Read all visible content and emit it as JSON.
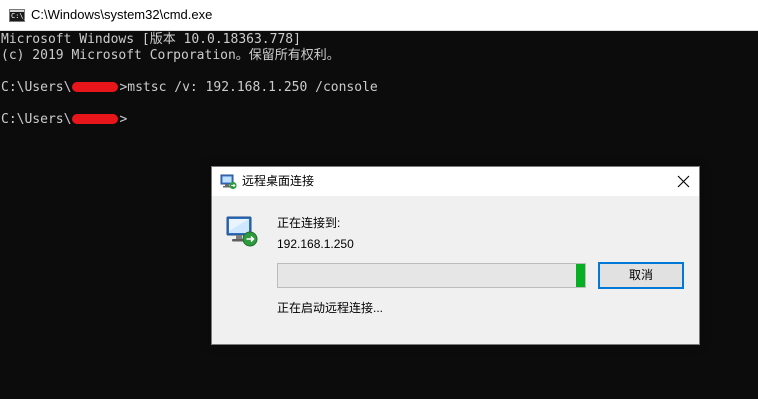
{
  "console_window": {
    "title": "C:\\Windows\\system32\\cmd.exe",
    "icon": "cmd-icon",
    "icon_text": "C:\\_",
    "lines": [
      "Microsoft Windows [版本 10.0.18363.778]",
      "(c) 2019 Microsoft Corporation。保留所有权利。",
      "",
      "C:\\Users\\",
      "",
      "C:\\Users\\"
    ],
    "command": "mstsc /v: 192.168.1.250 /console",
    "prompt_suffix": ">",
    "redaction_color": "#e8151b"
  },
  "dialog": {
    "title": "远程桌面连接",
    "title_icon": "remote-desktop-icon",
    "close_icon": "close-icon",
    "heading": "正在连接到:",
    "host": "192.168.1.250",
    "progress_fraction": 0.03,
    "progress_color": "#06b025",
    "cancel_label": "取消",
    "status": "正在启动远程连接..."
  }
}
